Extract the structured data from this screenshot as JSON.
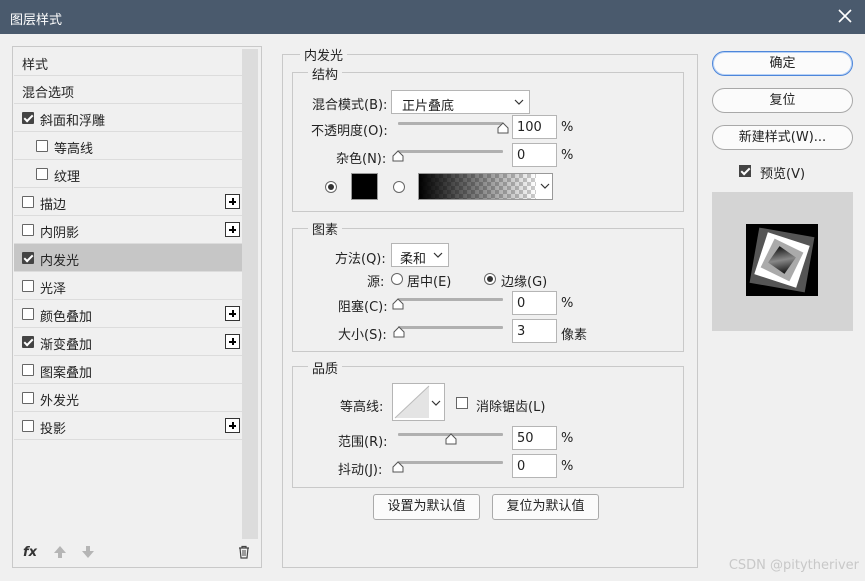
{
  "window": {
    "title": "图层样式"
  },
  "styles_list": [
    {
      "label": "样式",
      "checkbox": false,
      "checked": false,
      "indent": 0,
      "plus": false,
      "selected": false
    },
    {
      "label": "混合选项",
      "checkbox": false,
      "checked": false,
      "indent": 0,
      "plus": false,
      "selected": false
    },
    {
      "label": "斜面和浮雕",
      "checkbox": true,
      "checked": true,
      "indent": 0,
      "plus": false,
      "selected": false
    },
    {
      "label": "等高线",
      "checkbox": true,
      "checked": false,
      "indent": 1,
      "plus": false,
      "selected": false
    },
    {
      "label": "纹理",
      "checkbox": true,
      "checked": false,
      "indent": 1,
      "plus": false,
      "selected": false
    },
    {
      "label": "描边",
      "checkbox": true,
      "checked": false,
      "indent": 0,
      "plus": true,
      "selected": false
    },
    {
      "label": "内阴影",
      "checkbox": true,
      "checked": false,
      "indent": 0,
      "plus": true,
      "selected": false
    },
    {
      "label": "内发光",
      "checkbox": true,
      "checked": true,
      "indent": 0,
      "plus": false,
      "selected": true
    },
    {
      "label": "光泽",
      "checkbox": true,
      "checked": false,
      "indent": 0,
      "plus": false,
      "selected": false
    },
    {
      "label": "颜色叠加",
      "checkbox": true,
      "checked": false,
      "indent": 0,
      "plus": true,
      "selected": false
    },
    {
      "label": "渐变叠加",
      "checkbox": true,
      "checked": true,
      "indent": 0,
      "plus": true,
      "selected": false
    },
    {
      "label": "图案叠加",
      "checkbox": true,
      "checked": false,
      "indent": 0,
      "plus": false,
      "selected": false
    },
    {
      "label": "外发光",
      "checkbox": true,
      "checked": false,
      "indent": 0,
      "plus": false,
      "selected": false
    },
    {
      "label": "投影",
      "checkbox": true,
      "checked": false,
      "indent": 0,
      "plus": true,
      "selected": false
    }
  ],
  "footer_icons": [
    "fx-icon",
    "move-up-icon",
    "move-down-icon",
    "trash-icon"
  ],
  "panel": {
    "title": "内发光",
    "structure": {
      "title": "结构",
      "blend_mode_label": "混合模式(B):",
      "blend_mode_value": "正片叠底",
      "opacity_label": "不透明度(O):",
      "opacity_value": "100",
      "opacity_unit": "%",
      "opacity_level": 1.0,
      "noise_label": "杂色(N):",
      "noise_value": "0",
      "noise_unit": "%",
      "noise_level": 0.0,
      "color_swatch": "#000000"
    },
    "elements": {
      "title": "图素",
      "method_label": "方法(Q):",
      "method_value": "柔和",
      "source_label": "源:",
      "source_center": "居中(E)",
      "source_edge": "边缘(G)",
      "choke_label": "阻塞(C):",
      "choke_value": "0",
      "choke_unit": "%",
      "choke_level": 0.0,
      "size_label": "大小(S):",
      "size_value": "3",
      "size_unit": "像素",
      "size_level": 0.012
    },
    "quality": {
      "title": "品质",
      "contour_label": "等高线:",
      "antialias_label": "消除锯齿(L)",
      "range_label": "范围(R):",
      "range_value": "50",
      "range_unit": "%",
      "range_level": 0.5,
      "jitter_label": "抖动(J):",
      "jitter_value": "0",
      "jitter_unit": "%",
      "jitter_level": 0.0
    },
    "make_default": "设置为默认值",
    "reset_default": "复位为默认值"
  },
  "right": {
    "ok": "确定",
    "reset": "复位",
    "new_style": "新建样式(W)...",
    "preview_label": "预览(V)"
  },
  "watermark": "CSDN @pitytheriver"
}
